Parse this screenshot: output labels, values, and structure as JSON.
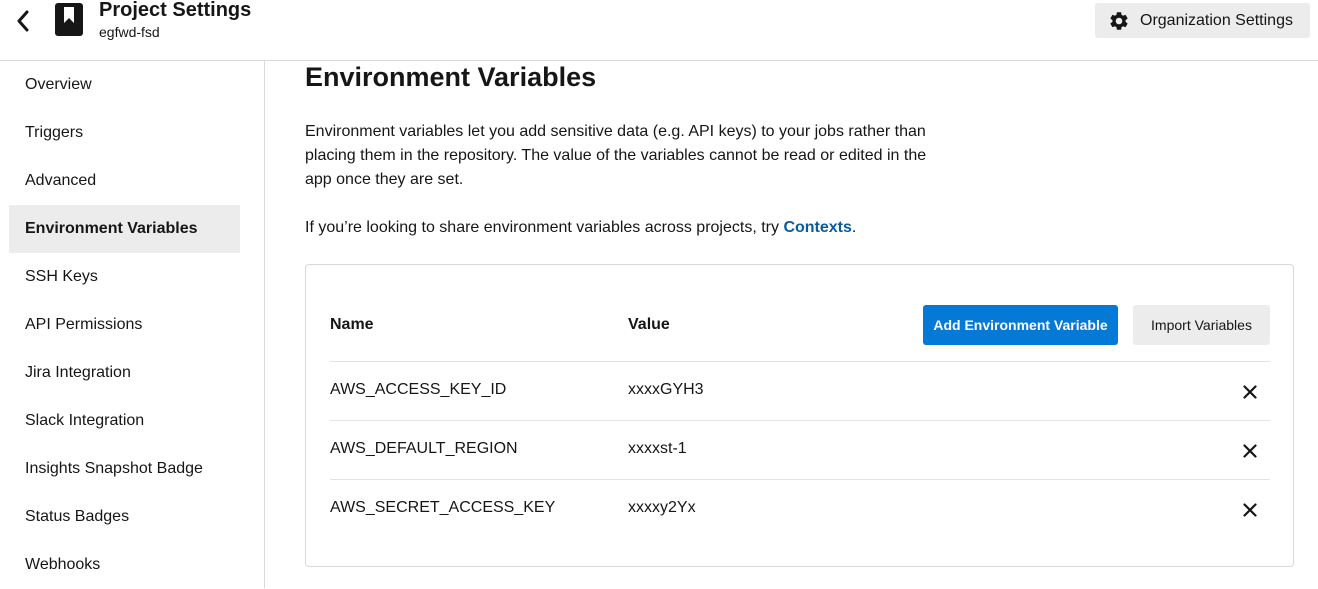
{
  "header": {
    "title": "Project Settings",
    "project": "egfwd-fsd",
    "org_settings_label": "Organization Settings"
  },
  "sidebar": {
    "items": [
      {
        "label": "Overview"
      },
      {
        "label": "Triggers"
      },
      {
        "label": "Advanced"
      },
      {
        "label": "Environment Variables",
        "active": true
      },
      {
        "label": "SSH Keys"
      },
      {
        "label": "API Permissions"
      },
      {
        "label": "Jira Integration"
      },
      {
        "label": "Slack Integration"
      },
      {
        "label": "Insights Snapshot Badge"
      },
      {
        "label": "Status Badges"
      },
      {
        "label": "Webhooks"
      }
    ]
  },
  "main": {
    "title": "Environment Variables",
    "description": "Environment variables let you add sensitive data (e.g. API keys) to your jobs rather than placing them in the repository. The value of the variables cannot be read or edited in the app once they are set.",
    "contexts_prefix": "If you’re looking to share environment variables across projects, try ",
    "contexts_link": "Contexts",
    "contexts_suffix": "."
  },
  "table": {
    "col_name": "Name",
    "col_value": "Value",
    "add_button": "Add Environment Variable",
    "import_button": "Import Variables",
    "rows": [
      {
        "name": "AWS_ACCESS_KEY_ID",
        "value": "xxxxGYH3"
      },
      {
        "name": "AWS_DEFAULT_REGION",
        "value": "xxxxst-1"
      },
      {
        "name": "AWS_SECRET_ACCESS_KEY",
        "value": "xxxxy2Yx"
      }
    ]
  },
  "colors": {
    "primary": "#0479d6",
    "link": "#0a5b9e",
    "secondary_bg": "#ececec",
    "text": "#161616"
  },
  "icons": {
    "back": "chevron-left-icon",
    "project": "bookmark-icon",
    "org": "gear-icon",
    "delete": "close-icon"
  }
}
